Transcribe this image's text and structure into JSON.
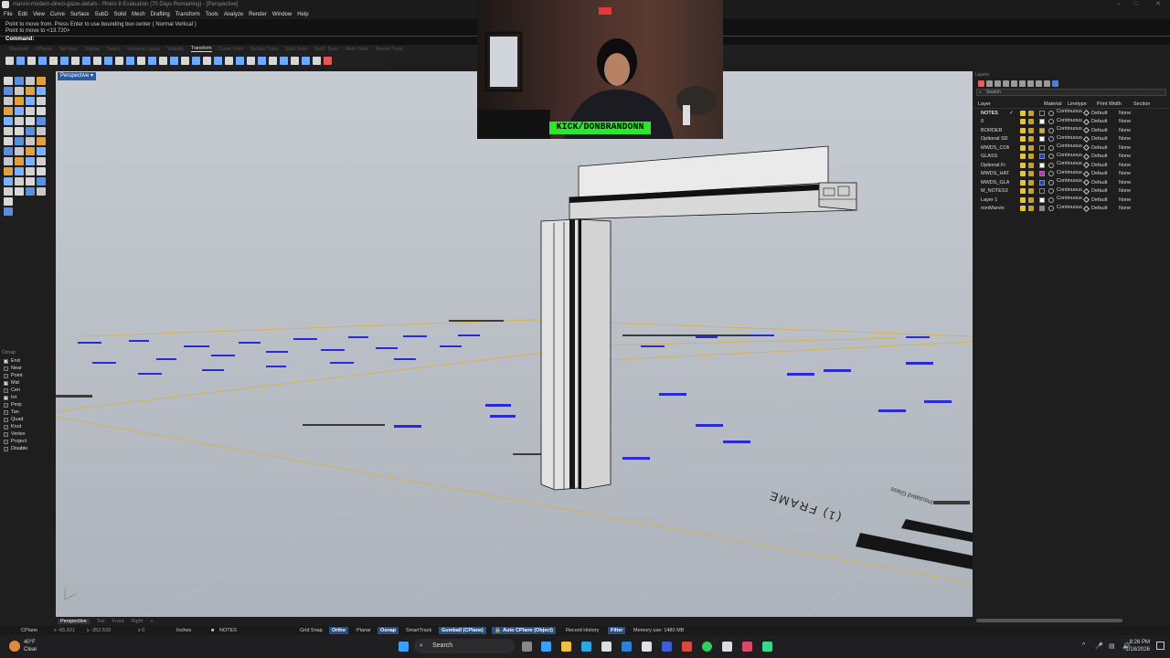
{
  "window": {
    "title": "marvin-modern-direct-glaze-details - Rhino 8 Evaluation (70 Days Remaining) - [Perspective]"
  },
  "menu": [
    "File",
    "Edit",
    "View",
    "Curve",
    "Surface",
    "SubD",
    "Solid",
    "Mesh",
    "Drafting",
    "Transform",
    "Tools",
    "Analyze",
    "Render",
    "Window",
    "Help"
  ],
  "command": {
    "history1": "Point to move from. Press Enter to use bounding box center ( Normal  Vertical )",
    "history2": "Point to move to <13.720>",
    "prompt": "Command:"
  },
  "tabs": [
    {
      "label": "Standard",
      "active": false
    },
    {
      "label": "CPlanes",
      "active": false
    },
    {
      "label": "Set View",
      "active": false
    },
    {
      "label": "Display",
      "active": false
    },
    {
      "label": "Select",
      "active": false
    },
    {
      "label": "Viewport Layout",
      "active": false
    },
    {
      "label": "Visibility",
      "active": false
    },
    {
      "label": "Transform",
      "active": true
    },
    {
      "label": "Curve Tools",
      "active": false
    },
    {
      "label": "Surface Tools",
      "active": false
    },
    {
      "label": "Solid Tools",
      "active": false
    },
    {
      "label": "SubD Tools",
      "active": false
    },
    {
      "label": "Mesh Tools",
      "active": false
    },
    {
      "label": "Render Tools",
      "active": false
    }
  ],
  "viewport": {
    "label": "Perspective",
    "annotations": {
      "frame_text": "(1) FRAME",
      "glass_text": "Insulated Glass"
    }
  },
  "webcam": {
    "banner": "KICK/DONBRANDONN"
  },
  "osnap": {
    "title": "Osnap",
    "items": [
      {
        "label": "End",
        "checked": true
      },
      {
        "label": "Near",
        "checked": false
      },
      {
        "label": "Point",
        "checked": false
      },
      {
        "label": "Mid",
        "checked": true
      },
      {
        "label": "Cen",
        "checked": false
      },
      {
        "label": "Int",
        "checked": true
      },
      {
        "label": "Perp",
        "checked": false
      },
      {
        "label": "Tan",
        "checked": false
      },
      {
        "label": "Quad",
        "checked": false
      },
      {
        "label": "Knot",
        "checked": false
      },
      {
        "label": "Vertex",
        "checked": false
      },
      {
        "label": "Project",
        "checked": false
      },
      {
        "label": "Disable",
        "checked": false
      }
    ]
  },
  "layers": {
    "title": "Layers",
    "search_placeholder": "Search",
    "columns": [
      "Layer",
      "Material",
      "Linetype",
      "Print Width",
      "Section"
    ],
    "rows": [
      {
        "name": "NOTES",
        "color": "#1a1a1a",
        "linetype": "Continuous",
        "print_width": "Default",
        "section": "None",
        "current": true
      },
      {
        "name": "0",
        "color": "#ffffff",
        "linetype": "Continuous",
        "print_width": "Default",
        "section": "None",
        "current": false
      },
      {
        "name": "BORDER",
        "color": "#e0b21a",
        "linetype": "Continuous",
        "print_width": "Default",
        "section": "None",
        "current": false
      },
      {
        "name": "Optional SD",
        "color": "#ffffff",
        "linetype": "Continuous",
        "print_width": "Default",
        "section": "None",
        "current": false
      },
      {
        "name": "MWDS_COMP",
        "color": "#1a1a1a",
        "linetype": "Continuous",
        "print_width": "Default",
        "section": "None",
        "current": false
      },
      {
        "name": "GLASS",
        "color": "#1e3cd8",
        "linetype": "Continuous",
        "print_width": "Default",
        "section": "None",
        "current": false
      },
      {
        "name": "Optional Fr",
        "color": "#ffffff",
        "linetype": "Continuous",
        "print_width": "Default",
        "section": "None",
        "current": false
      },
      {
        "name": "MWDS_HATC",
        "color": "#d81ed8",
        "linetype": "Continuous",
        "print_width": "Default",
        "section": "None",
        "current": false
      },
      {
        "name": "MWDS_GLAS",
        "color": "#1e3cd8",
        "linetype": "Continuous",
        "print_width": "Default",
        "section": "None",
        "current": false
      },
      {
        "name": "M_NOTES3",
        "color": "#1a1a1a",
        "linetype": "Continuous",
        "print_width": "Default",
        "section": "None",
        "current": false
      },
      {
        "name": "Layer 1",
        "color": "#ffffff",
        "linetype": "Continuous",
        "print_width": "Default",
        "section": "None",
        "current": false
      },
      {
        "name": "nonMarvin",
        "color": "#888888",
        "linetype": "Continuous",
        "print_width": "Default",
        "section": "None",
        "current": false
      }
    ]
  },
  "viewtabs": [
    {
      "label": "Perspective",
      "active": true
    },
    {
      "label": "Top",
      "active": false
    },
    {
      "label": "Front",
      "active": false
    },
    {
      "label": "Right",
      "active": false
    },
    {
      "label": "+",
      "active": false
    }
  ],
  "status": {
    "cplane": "CPlane",
    "x": "x -65.921",
    "y": "y -352.533",
    "z": "z 0",
    "units": "Inches",
    "layer": "NOTES",
    "grid_snap": "Grid Snap",
    "ortho": "Ortho",
    "planar": "Planar",
    "osnap": "Osnap",
    "smarttrack": "SmartTrack",
    "gumball": "Gumball (CPlane)",
    "auto_cplane": "Auto CPlane (Object)",
    "record_history": "Record History",
    "filter": "Filter",
    "memory": "Memory use: 1480 MB"
  },
  "taskbar": {
    "temp": "40°F",
    "weather": "Clear",
    "search": "Search",
    "time": "8:26 PM",
    "date": "1/18/2026"
  }
}
